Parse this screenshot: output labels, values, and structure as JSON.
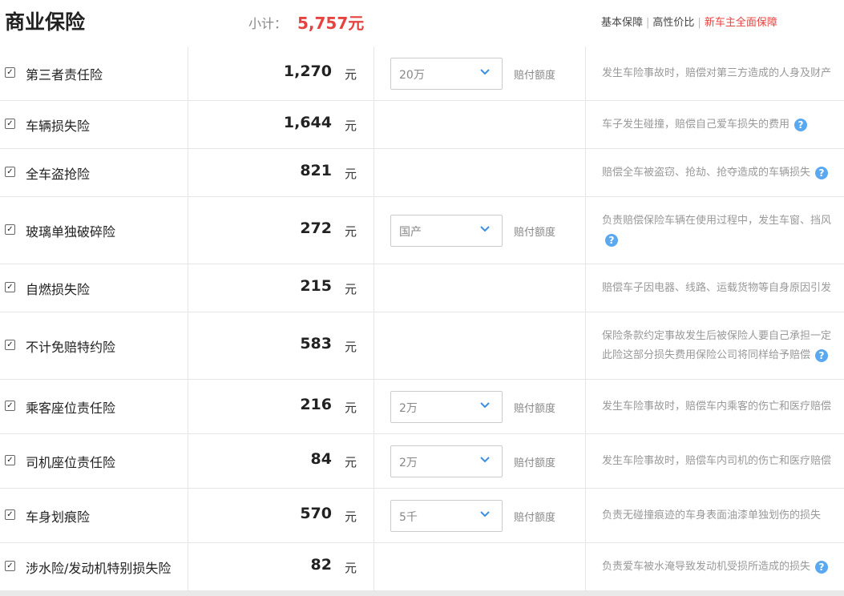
{
  "header": {
    "title": "商业保险",
    "subtotal_label": "小计：",
    "subtotal_value": "5,757元",
    "filters": [
      "基本保障",
      "高性价比",
      "新车主全面保障"
    ]
  },
  "colors": {
    "accent": "#e64340",
    "help": "#5aa9f0"
  },
  "rows": [
    {
      "checked": true,
      "name": "第三者责任险",
      "price": "1,270",
      "unit": "元",
      "select": "20万",
      "limit_label": "赔付额度",
      "desc": [
        "发生车险事故时，赔偿对第三方造成的人身及财产"
      ],
      "help": false
    },
    {
      "checked": true,
      "name": "车辆损失险",
      "price": "1,644",
      "unit": "元",
      "select": null,
      "limit_label": null,
      "desc": [
        "车子发生碰撞，赔偿自己爱车损失的费用"
      ],
      "help": true
    },
    {
      "checked": true,
      "name": "全车盗抢险",
      "price": "821",
      "unit": "元",
      "select": null,
      "limit_label": null,
      "desc": [
        "赔偿全车被盗窃、抢劫、抢夺造成的车辆损失"
      ],
      "help": true
    },
    {
      "checked": true,
      "name": "玻璃单独破碎险",
      "price": "272",
      "unit": "元",
      "select": "国产",
      "limit_label": "赔付额度",
      "desc": [
        "负责赔偿保险车辆在使用过程中，发生车窗、挡风"
      ],
      "help": true
    },
    {
      "checked": true,
      "name": "自燃损失险",
      "price": "215",
      "unit": "元",
      "select": null,
      "limit_label": null,
      "desc": [
        "赔偿车子因电器、线路、运载货物等自身原因引发"
      ],
      "help": false
    },
    {
      "checked": true,
      "name": "不计免赔特约险",
      "price": "583",
      "unit": "元",
      "select": null,
      "limit_label": null,
      "desc": [
        "保险条款约定事故发生后被保险人要自己承担一定",
        "此险这部分损失费用保险公司将同样给予赔偿"
      ],
      "help": true
    },
    {
      "checked": true,
      "name": "乘客座位责任险",
      "price": "216",
      "unit": "元",
      "select": "2万",
      "limit_label": "赔付额度",
      "desc": [
        "发生车险事故时，赔偿车内乘客的伤亡和医疗赔偿"
      ],
      "help": false
    },
    {
      "checked": true,
      "name": "司机座位责任险",
      "price": "84",
      "unit": "元",
      "select": "2万",
      "limit_label": "赔付额度",
      "desc": [
        "发生车险事故时，赔偿车内司机的伤亡和医疗赔偿"
      ],
      "help": false
    },
    {
      "checked": true,
      "name": "车身划痕险",
      "price": "570",
      "unit": "元",
      "select": "5千",
      "limit_label": "赔付额度",
      "desc": [
        "负责无碰撞痕迹的车身表面油漆单独划伤的损失"
      ],
      "help": false
    },
    {
      "checked": true,
      "name": "涉水险/发动机特别损失险",
      "price": "82",
      "unit": "元",
      "select": null,
      "limit_label": null,
      "desc": [
        "负责爱车被水淹导致发动机受损所造成的损失"
      ],
      "help": true
    }
  ]
}
